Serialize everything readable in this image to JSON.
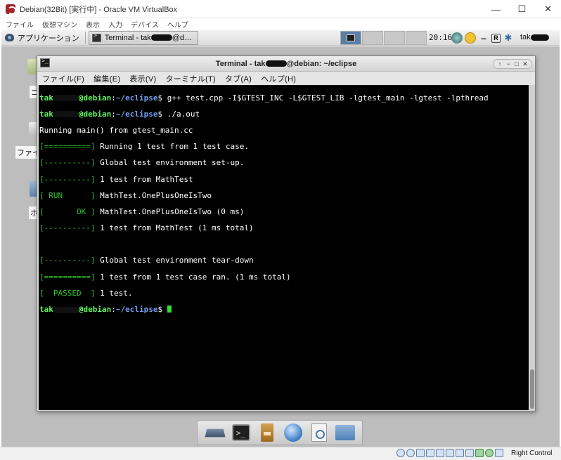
{
  "host": {
    "title": "Debian(32Bit) [実行中] - Oracle VM VirtualBox",
    "controls": [
      "—",
      "☐",
      "✕"
    ],
    "menu": [
      "ファイル",
      "仮想マシン",
      "表示",
      "入力",
      "デバイス",
      "ヘルプ"
    ],
    "status_right": "Right Control"
  },
  "guest_panel": {
    "apps_label": "アプリケーション",
    "task_label": "Terminal - tak",
    "task_label_suffix": "@d…",
    "clock": "20:16",
    "tray_r": "R",
    "user": "tak"
  },
  "desktop": {
    "icon_labels": [
      "ゴ",
      "ファイ",
      "ホ"
    ]
  },
  "terminal": {
    "title": "Terminal - tak",
    "title_suffix": "@debian: ~/eclipse",
    "wm_buttons": [
      "↑",
      "−",
      "□",
      "✕"
    ],
    "menu": [
      "ファイル(F)",
      "編集(E)",
      "表示(V)",
      "ターミナル(T)",
      "タブ(A)",
      "ヘルプ(H)"
    ],
    "prompt_user": "tak",
    "prompt_host": "@debian",
    "prompt_path": "~/eclipse",
    "cmd1": " g++ test.cpp -I$GTEST_INC -L$GTEST_LIB -lgtest_main -lgtest -lpthread",
    "cmd2": " ./a.out",
    "output": {
      "running_main": "Running main() from gtest_main.cc",
      "l1_tag": "[==========]",
      "l1_text": " Running 1 test from 1 test case.",
      "l2_tag": "[----------]",
      "l2_text": " Global test environment set-up.",
      "l3_tag": "[----------]",
      "l3_text": " 1 test from MathTest",
      "l4_tag": "[ RUN      ]",
      "l4_text": " MathTest.OnePlusOneIsTwo",
      "l5_tag": "[       OK ]",
      "l5_text": " MathTest.OnePlusOneIsTwo (0 ms)",
      "l6_tag": "[----------]",
      "l6_text": " 1 test from MathTest (1 ms total)",
      "l7_tag": "[----------]",
      "l7_text": " Global test environment tear-down",
      "l8_tag": "[==========]",
      "l8_text": " 1 test from 1 test case ran. (1 ms total)",
      "l9_tag": "[  PASSED  ]",
      "l9_text": " 1 test."
    }
  },
  "colors": {
    "prompt_user": "#5ff85f",
    "prompt_path": "#729fef",
    "gtest_tag": "#2fc22f",
    "terminal_bg": "#000000",
    "desktop_bg": "#bdbdbd"
  },
  "dock": {
    "icons": [
      "show-desktop-icon",
      "terminal-icon",
      "file-manager-icon",
      "web-browser-icon",
      "app-finder-icon",
      "folder-icon"
    ]
  }
}
